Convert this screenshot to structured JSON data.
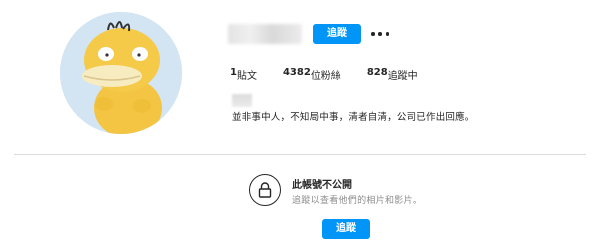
{
  "profile": {
    "avatar_icon": "psyduck-avatar-icon",
    "follow_label": "追蹤",
    "more_icon": "more-options-icon",
    "stats": [
      {
        "value": "1",
        "label": "貼文"
      },
      {
        "value": "4382",
        "label": "位粉絲"
      },
      {
        "value": "828",
        "label": "追蹤中"
      }
    ],
    "bio": "並非事中人，不知局中事，清者自清，公司已作出回應。"
  },
  "private_notice": {
    "lock_icon": "lock-icon",
    "title": "此帳號不公開",
    "subtitle": "追蹤以查看他們的相片和影片。",
    "follow_label": "追蹤"
  },
  "colors": {
    "accent": "#0095f6",
    "text": "#262626",
    "muted": "#8e8e8e",
    "divider": "#dbdbdb"
  }
}
